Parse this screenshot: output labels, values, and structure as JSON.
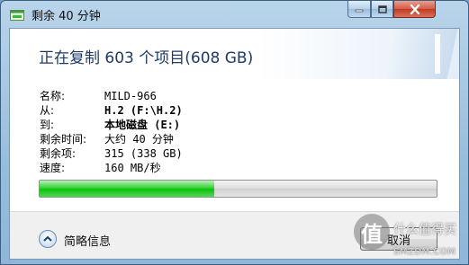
{
  "window": {
    "title": "剩余 40 分钟",
    "icon": "copy-window-icon"
  },
  "header": {
    "title": "正在复制 603 个项目(608 GB)"
  },
  "details": [
    {
      "label": "名称:",
      "value": "MILD-966",
      "bold": false
    },
    {
      "label": "从:",
      "value": "H.2 (F:\\H.2)",
      "bold": true
    },
    {
      "label": "到:",
      "value": "本地磁盘 (E:)",
      "bold": true
    },
    {
      "label": "剩余时间:",
      "value": "大约 40 分钟",
      "bold": false
    },
    {
      "label": "剩余项:",
      "value": "315 (338 GB)",
      "bold": false
    },
    {
      "label": "速度:",
      "value": "160 MB/秒",
      "bold": false
    }
  ],
  "progress": {
    "fraction": 0.44,
    "color": "#22cc22"
  },
  "footer": {
    "details_label": "简略信息",
    "cancel_label": "取消"
  },
  "watermark": {
    "badge": "值",
    "text": "什么值得买",
    "site": "SMZDM.COM"
  }
}
